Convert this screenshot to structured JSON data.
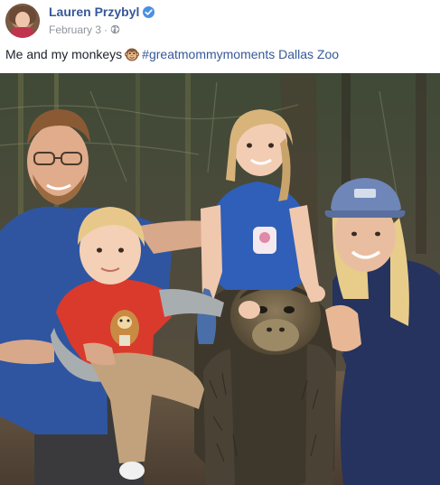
{
  "post": {
    "author": {
      "name": "Lauren Przybyl",
      "verified_icon": "verified-badge-icon"
    },
    "meta": {
      "date": "February 3",
      "separator": "·",
      "privacy_icon": "globe-icon"
    },
    "caption": {
      "text": "Me and my monkeys",
      "emoji_icon": "monkey-face-icon",
      "hashtag": "#greatmommymoments",
      "place": "Dallas Zoo"
    },
    "photo": {
      "scene": "family-with-gorilla-statue"
    }
  },
  "colors": {
    "link": "#365899",
    "text": "#1d2129",
    "meta": "#90949c",
    "verified": "#4a90e2"
  }
}
